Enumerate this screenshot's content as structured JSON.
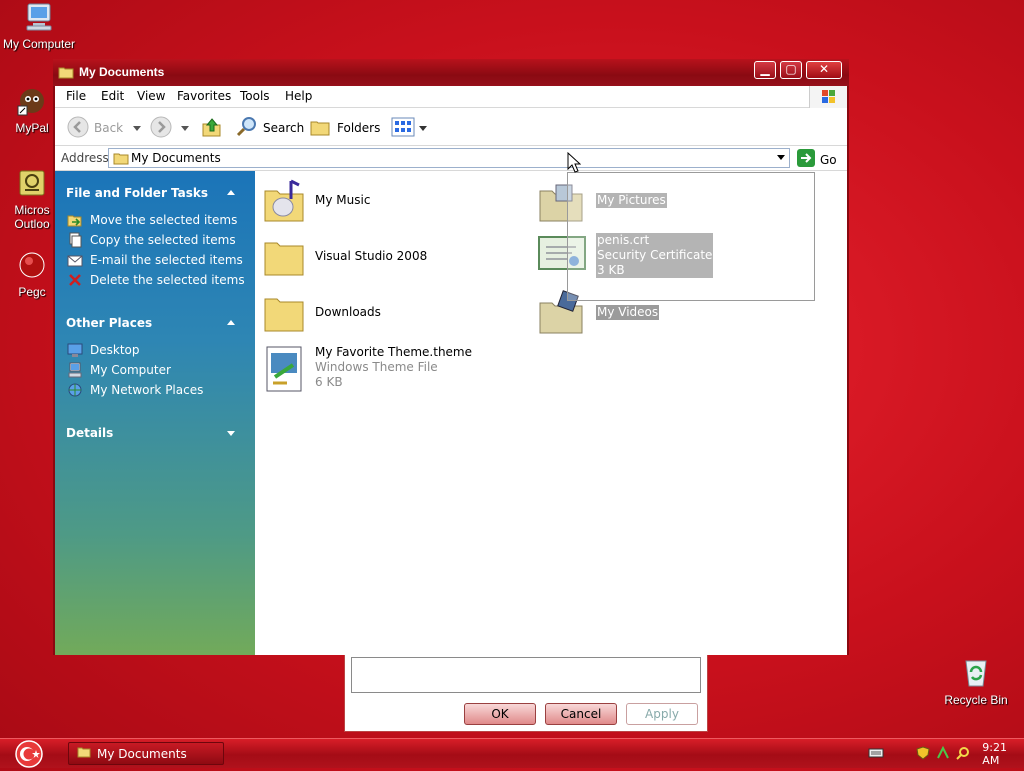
{
  "desktop": {
    "icons": [
      {
        "label": "My Computer"
      },
      {
        "label": "MyPal"
      },
      {
        "label": "Micros Outloo"
      },
      {
        "label": "Pegc"
      },
      {
        "label": "Recycle Bin"
      }
    ]
  },
  "window": {
    "title": "My Documents",
    "controls": {
      "minimize": "▁",
      "maximize": "▢",
      "close": "✕"
    }
  },
  "menu": [
    "File",
    "Edit",
    "View",
    "Favorites",
    "Tools",
    "Help"
  ],
  "toolbar": {
    "back": "Back",
    "search": "Search",
    "folders": "Folders"
  },
  "address": {
    "label": "Address",
    "value": "My Documents",
    "go": "Go"
  },
  "taskpane": {
    "sections": [
      {
        "title": "File and Folder Tasks",
        "items": [
          "Move the selected items",
          "Copy the selected items",
          "E-mail the selected items",
          "Delete the selected items"
        ]
      },
      {
        "title": "Other Places",
        "items": [
          "Desktop",
          "My Computer",
          "My Network Places"
        ]
      },
      {
        "title": "Details",
        "items": []
      }
    ]
  },
  "files": [
    {
      "name": "My Music",
      "icon": "music-folder-icon"
    },
    {
      "name": "My Pictures",
      "icon": "pictures-folder-icon",
      "selected": true
    },
    {
      "name": "Visual Studio 2008",
      "icon": "folder-icon"
    },
    {
      "name": "penis.crt",
      "type": "Security Certificate",
      "size": "3 KB",
      "icon": "certificate-icon",
      "selected": true
    },
    {
      "name": "Downloads",
      "icon": "folder-icon"
    },
    {
      "name": "My Videos",
      "icon": "videos-folder-icon",
      "selected": true
    },
    {
      "name": "My Favorite Theme.theme",
      "type": "Windows Theme File",
      "size": "6 KB",
      "icon": "theme-file-icon"
    }
  ],
  "dialog": {
    "ok": "OK",
    "cancel": "Cancel",
    "apply": "Apply"
  },
  "taskbar": {
    "task": "My Documents",
    "clock": "9:21 AM"
  },
  "colors": {
    "desktop": "#c8101c",
    "titlebar": "#9a0c14",
    "selection": "#9b9b9b",
    "taskpane_top": "#1b74b8",
    "taskpane_bottom": "#72aa5a"
  }
}
